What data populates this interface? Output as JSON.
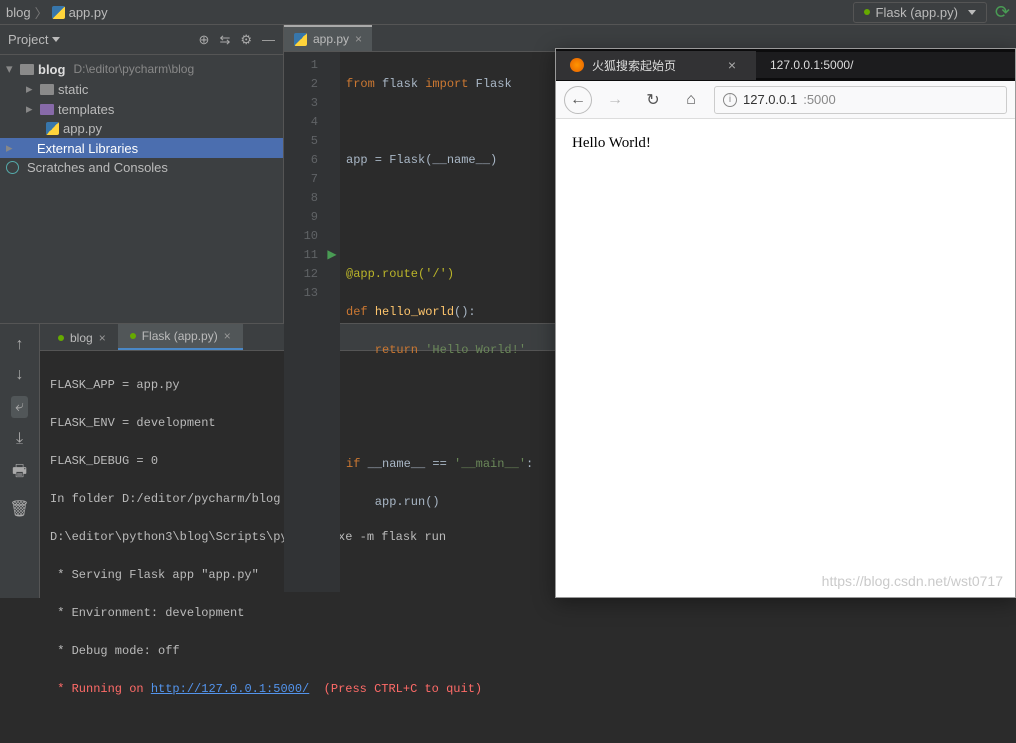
{
  "breadcrumb": {
    "root": "blog",
    "file": "app.py"
  },
  "runConfig": {
    "label": "Flask (app.py)"
  },
  "projectPanel": {
    "title": "Project",
    "root": {
      "name": "blog",
      "path": "D:\\editor\\pycharm\\blog"
    },
    "folders": [
      {
        "name": "static"
      },
      {
        "name": "templates"
      }
    ],
    "file": "app.py",
    "externalLibs": "External Libraries",
    "scratches": "Scratches and Consoles"
  },
  "editorTab": {
    "name": "app.py"
  },
  "code": {
    "lines": [
      "1",
      "2",
      "3",
      "4",
      "5",
      "6",
      "7",
      "8",
      "9",
      "10",
      "11",
      "12",
      "13"
    ],
    "l1_from": "from",
    "l1_flask": " flask ",
    "l1_import": "import",
    "l1_Flask": " Flask",
    "l3": "app = Flask(__name__)",
    "l6": "@app.route",
    "l6_arg": "('/')",
    "l7_def": "def ",
    "l7_fn": "hello_world",
    "l7_paren": "():",
    "l8_return": "    return ",
    "l8_str": "'Hello World!'",
    "l11_if": "if ",
    "l11_name": "__name__ == ",
    "l11_main": "'__main__'",
    "l11_colon": ":",
    "l12": "    app.run()"
  },
  "runTabs": {
    "blog": "blog",
    "flask": "Flask (app.py)"
  },
  "console": {
    "l1": "FLASK_APP = app.py",
    "l2": "FLASK_ENV = development",
    "l3": "FLASK_DEBUG = 0",
    "l4": "In folder D:/editor/pycharm/blog",
    "l5": "D:\\editor\\python3\\blog\\Scripts\\python3.exe -m flask run",
    "l6": " * Serving Flask app \"app.py\"",
    "l7": " * Environment: development",
    "l8": " * Debug mode: off",
    "l9a": " * Running on ",
    "l9link": "http://127.0.0.1:5000/",
    "l9b": "  (Press CTRL+C to quit)"
  },
  "browser": {
    "tab1": "火狐搜索起始页",
    "tab2": "127.0.0.1:5000/",
    "addr_prefix": "127.0.0.1",
    "addr_suffix": ":5000",
    "body": "Hello World!"
  },
  "watermark": "https://blog.csdn.net/wst0717"
}
